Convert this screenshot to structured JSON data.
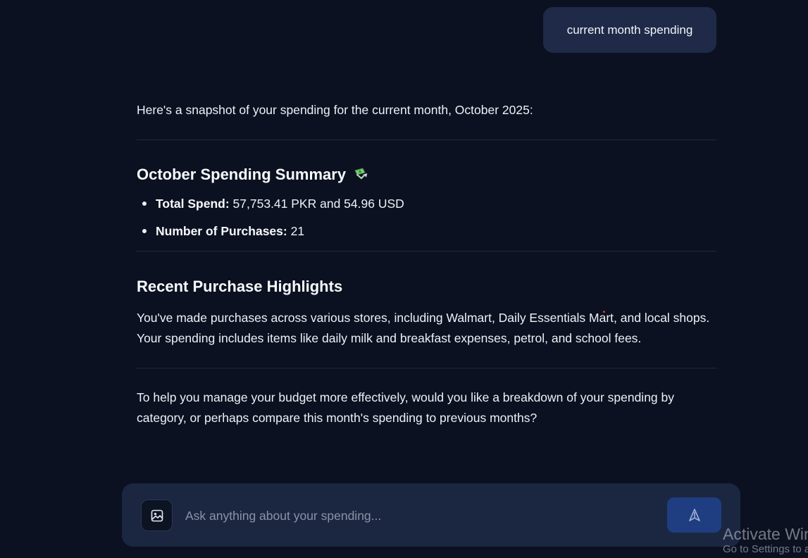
{
  "chat": {
    "user_message": "current month spending",
    "assistant": {
      "intro": "Here's a snapshot of your spending for the current month, October 2025:",
      "summary": {
        "title": "October Spending Summary",
        "emoji": "money-with-wings-icon",
        "items": [
          {
            "label": "Total Spend:",
            "value": "57,753.41 PKR and 54.96 USD"
          },
          {
            "label": "Number of Purchases:",
            "value": "21"
          }
        ]
      },
      "recent": {
        "title": "Recent Purchase Highlights",
        "text": "You've made purchases across various stores, including Walmart, Daily Essentials Mart, and local shops. Your spending includes items like daily milk and breakfast expenses, petrol, and school fees."
      },
      "closing": "To help you manage your budget more effectively, would you like a breakdown of your spending by category, or perhaps compare this month's spending to previous months?"
    }
  },
  "composer": {
    "placeholder": "Ask anything about your spending...",
    "image_button_icon": "image-icon",
    "send_button_icon": "send-icon"
  },
  "watermark": {
    "line1": "Activate Windows",
    "line2": "Go to Settings to activate Windows."
  },
  "colors": {
    "background": "#0b1120",
    "user_bubble": "#1e2a47",
    "composer": "#1b2640",
    "send_button": "#1f3e82"
  }
}
